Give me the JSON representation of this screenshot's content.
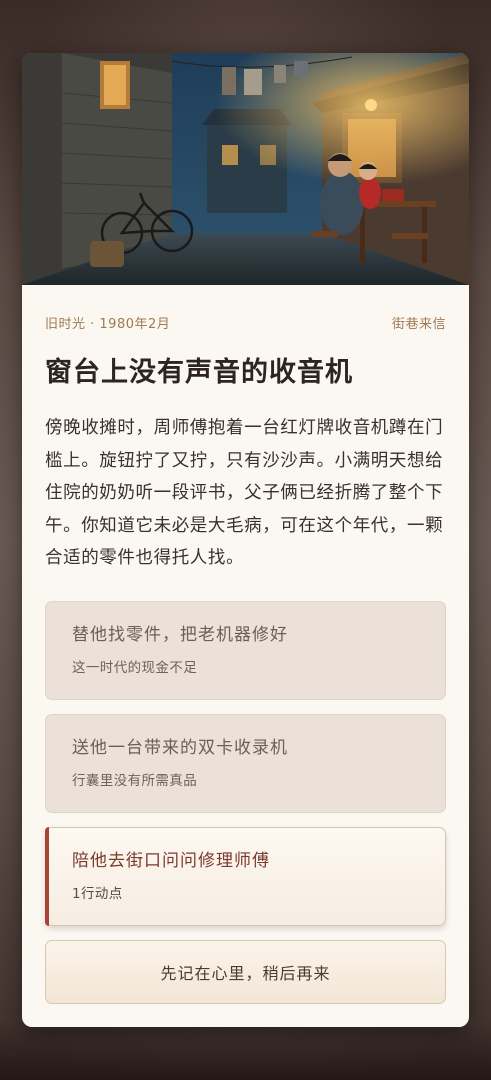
{
  "story": {
    "meta_left": "旧时光 · 1980年2月",
    "meta_right": "街巷来信",
    "title": "窗台上没有声音的收音机",
    "body": "傍晚收摊时，周师傅抱着一台红灯牌收音机蹲在门槛上。旋钮拧了又拧，只有沙沙声。小满明天想给住院的奶奶听一段评书，父子俩已经折腾了整个下午。你知道它未必是大毛病，可在这个年代，一颗合适的零件也得托人找。"
  },
  "hero": {
    "alt": "hutong-alley-night-illustration"
  },
  "choices": [
    {
      "title": "替他找零件，把老机器修好",
      "sub": "这一时代的现金不足",
      "state": "disabled"
    },
    {
      "title": "送他一台带来的双卡收录机",
      "sub": "行囊里没有所需真品",
      "state": "disabled"
    },
    {
      "title": "陪他去街口问问修理师傅",
      "sub": "1行动点",
      "state": "active"
    }
  ],
  "later_button": "先记在心里，稍后再来",
  "colors": {
    "accent": "#a8433a",
    "meta": "#a07a52",
    "card_bg": "#fbf8f2",
    "disabled_bg": "#ebe1d8"
  }
}
